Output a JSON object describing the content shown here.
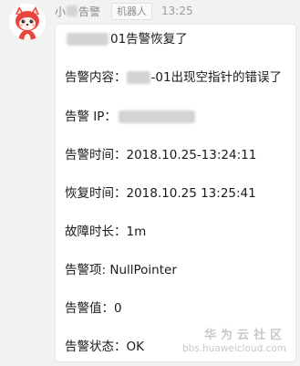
{
  "header": {
    "sender_prefix": "小",
    "sender_suffix": "告警",
    "badge": "机器人",
    "time": "13:25"
  },
  "message": {
    "title_suffix": "01告警恢复了",
    "content_label": "告警内容：",
    "content_value": "-01出现空指针的错误了",
    "ip_label": "告警 IP：",
    "alarm_time": "告警时间：2018.10.25-13:24:11",
    "recover_time": "恢复时间：2018.10.25 13:25:41",
    "duration": "故障时长：1m",
    "item": "告警项: NullPointer",
    "value": "告警值：0",
    "status": "告警状态：OK"
  },
  "watermark": {
    "title": "华为云社区",
    "url": "bbs.huaweicloud.com"
  },
  "icons": {
    "avatar": "cartoon-fox-avatar-icon"
  }
}
